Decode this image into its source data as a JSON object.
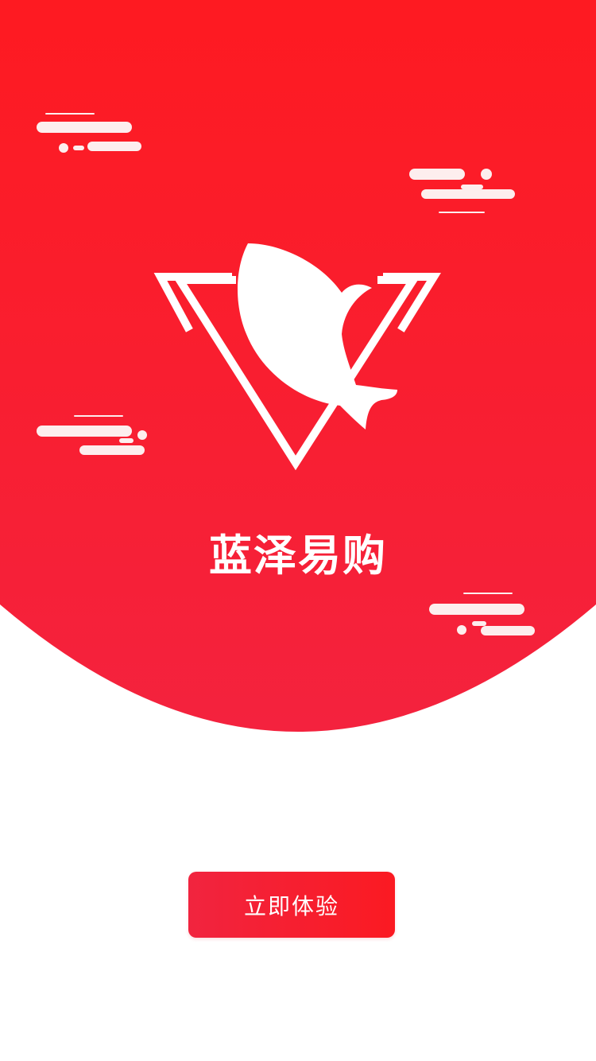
{
  "splash": {
    "app_name": "蓝泽易购",
    "logo_icon": "whale-triangle-logo-icon",
    "decoration_icon": "cloud-icon"
  },
  "cta": {
    "label": "立即体验"
  },
  "colors": {
    "hero_top": "#fe1a21",
    "hero_bottom": "#f4223e",
    "cloud": "#fdeeee",
    "text_light": "#ffffff",
    "background": "#ffffff"
  }
}
